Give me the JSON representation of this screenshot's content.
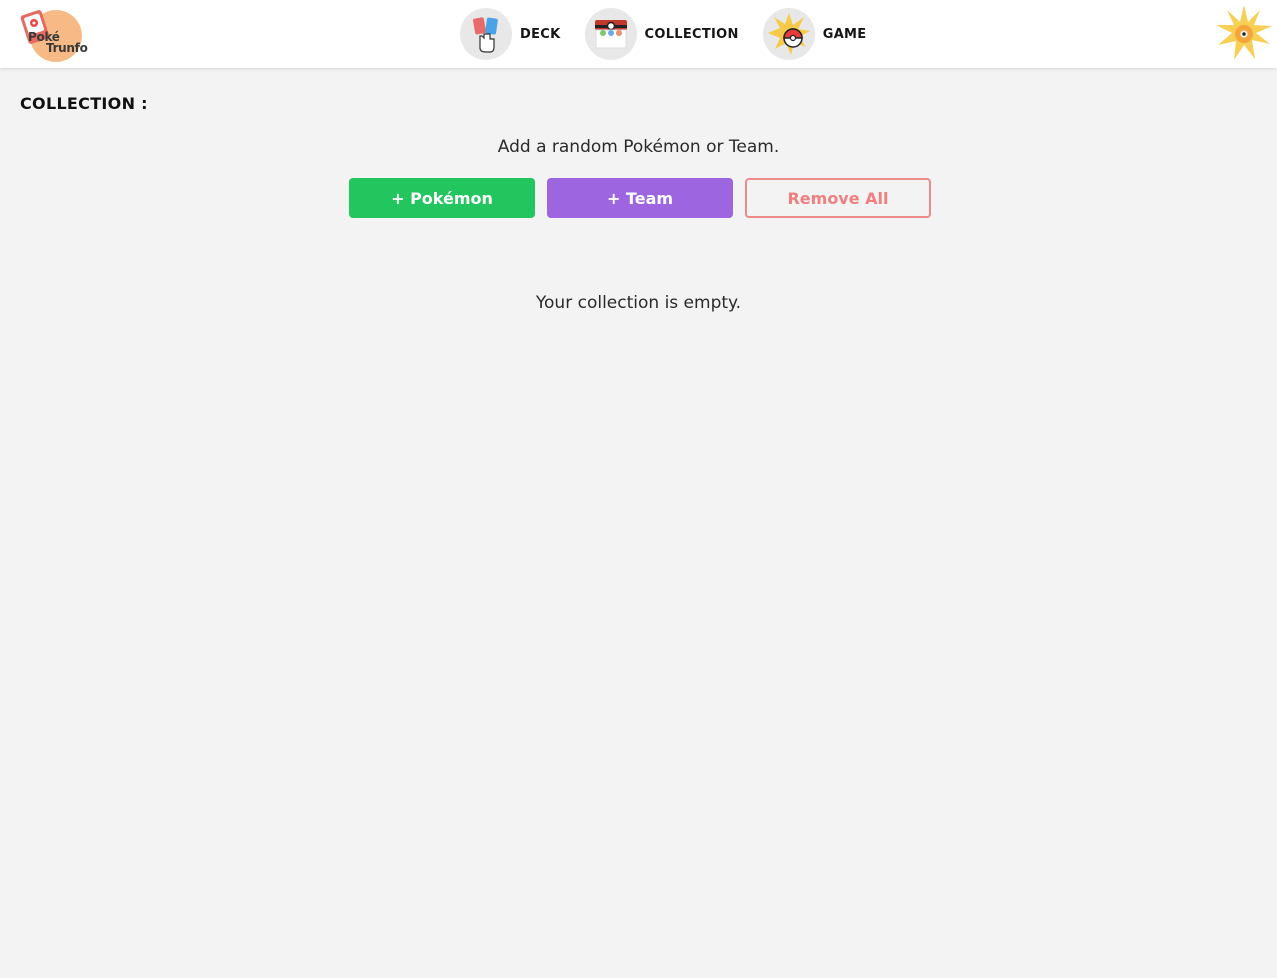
{
  "header": {
    "logo": {
      "line1": "Poké",
      "line2": "Trunfo"
    },
    "nav": [
      {
        "label": "DECK",
        "icon": "cards-hand-icon"
      },
      {
        "label": "COLLECTION",
        "icon": "pokeball-box-icon"
      },
      {
        "label": "GAME",
        "icon": "pokeball-burst-icon"
      }
    ],
    "theme_icon": "sun-icon"
  },
  "main": {
    "title": "COLLECTION :",
    "subtitle": "Add a random Pokémon or Team.",
    "buttons": {
      "add_pokemon": "+ Pokémon",
      "add_team": "+ Team",
      "remove_all": "Remove All"
    },
    "empty_message": "Your collection is empty."
  },
  "colors": {
    "add_pokemon": "#22c55e",
    "add_team": "#9d66e0",
    "remove_all": "#ef8080",
    "background": "#f3f3f3"
  }
}
